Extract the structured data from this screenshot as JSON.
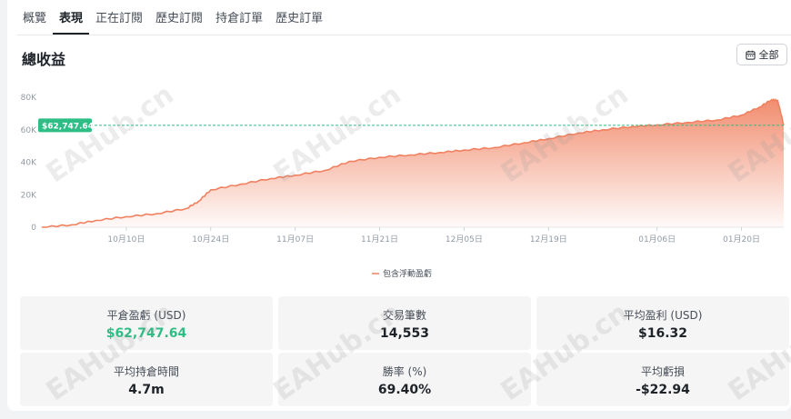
{
  "tabs": [
    {
      "label": "概覽"
    },
    {
      "label": "表現"
    },
    {
      "label": "正在訂閱"
    },
    {
      "label": "歷史訂閱"
    },
    {
      "label": "持倉訂單"
    },
    {
      "label": "歷史訂單"
    }
  ],
  "active_tab": "表現",
  "section_title": "總收益",
  "range_button": "全部",
  "watermark": "EAHub.cn",
  "chart_data": {
    "type": "area",
    "title": "",
    "series": [
      {
        "name": "包含浮動盈虧",
        "x": [
          "09-26",
          "10-01",
          "10-05",
          "10-10",
          "10-15",
          "10-20",
          "10-22",
          "10-24",
          "10-29",
          "11-03",
          "11-07",
          "11-12",
          "11-16",
          "11-21",
          "11-26",
          "12-01",
          "12-05",
          "12-10",
          "12-15",
          "12-19",
          "12-24",
          "12-28",
          "01-02",
          "01-06",
          "01-11",
          "01-16",
          "01-20",
          "01-23",
          "01-25",
          "01-26",
          "01-27"
        ],
        "values": [
          0,
          1500,
          4200,
          6500,
          8300,
          11500,
          16000,
          23000,
          26500,
          30000,
          32000,
          35000,
          40500,
          43000,
          44500,
          46000,
          47500,
          49000,
          52000,
          54500,
          58000,
          60000,
          62000,
          63000,
          64500,
          66000,
          69000,
          74000,
          78500,
          78000,
          62747.64
        ]
      }
    ],
    "yticks": [
      "0",
      "20K",
      "40K",
      "60K",
      "80K"
    ],
    "ylim": [
      0,
      90000
    ],
    "xticks": [
      "10月10日",
      "10月24日",
      "11月07日",
      "11月21日",
      "12月05日",
      "12月19日",
      "01月06日",
      "01月20日"
    ],
    "current_label": "$62,747.64",
    "current_value": 62747.64,
    "legend": "包含浮動盈虧",
    "legend_placement": "bottom-center",
    "line_color": "#f0805f",
    "marker_color": "#2ebd85"
  },
  "stats": [
    {
      "label": "平倉盈虧 (USD)",
      "value": "$62,747.64",
      "highlight": true
    },
    {
      "label": "交易筆數",
      "value": "14,553",
      "highlight": false
    },
    {
      "label": "平均盈利 (USD)",
      "value": "$16.32",
      "highlight": false
    },
    {
      "label": "平均持倉時間",
      "value": "4.7m",
      "highlight": false
    },
    {
      "label": "勝率 (%)",
      "value": "69.40%",
      "highlight": false
    },
    {
      "label": "平均虧損",
      "value": "-$22.94",
      "highlight": false
    }
  ]
}
